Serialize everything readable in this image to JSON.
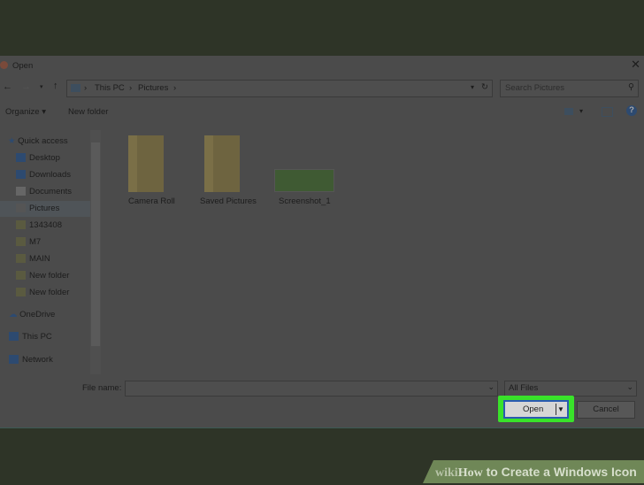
{
  "title": "Open",
  "breadcrumb": [
    "This PC",
    "Pictures"
  ],
  "search_placeholder": "Search Pictures",
  "toolbar": {
    "organize": "Organize",
    "new_folder": "New folder"
  },
  "sidebar": {
    "quick_access": "Quick access",
    "items": [
      {
        "label": "Desktop",
        "pinned": true
      },
      {
        "label": "Downloads",
        "pinned": true
      },
      {
        "label": "Documents",
        "pinned": true
      },
      {
        "label": "Pictures",
        "pinned": true
      },
      {
        "label": "1343408",
        "pinned": true
      },
      {
        "label": "M7"
      },
      {
        "label": "MAIN"
      },
      {
        "label": "New folder"
      },
      {
        "label": "New folder"
      }
    ],
    "onedrive": "OneDrive",
    "this_pc": "This PC",
    "network": "Network"
  },
  "files": [
    {
      "name": "Camera Roll",
      "type": "folder"
    },
    {
      "name": "Saved Pictures",
      "type": "folder"
    },
    {
      "name": "Screenshot_1",
      "type": "image"
    }
  ],
  "bottom": {
    "file_name_label": "File name:",
    "file_name_value": "",
    "file_type": "All Files",
    "open": "Open",
    "cancel": "Cancel"
  },
  "watermark": {
    "wiki": "wiki",
    "how": "How",
    "rest": " to Create a Windows Icon"
  },
  "colors": {
    "highlight": "#39e22a"
  }
}
